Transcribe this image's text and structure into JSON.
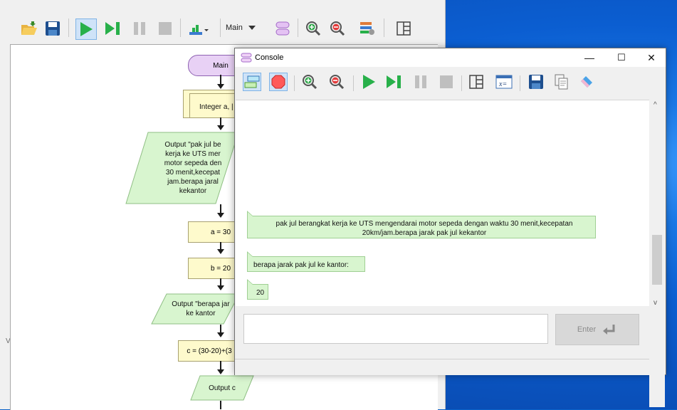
{
  "main_window": {
    "function_selector": "Main",
    "gutter_char": "V",
    "flowchart": {
      "start_label": "Main",
      "declare_label": "Integer a, |",
      "output1_lines": [
        "Output \"pak jul be",
        "kerja ke UTS mer",
        "motor sepeda den",
        "30 menit,kecepat",
        "jam.berapa jaral",
        "kekantor"
      ],
      "assign_a": "a = 30",
      "assign_b": "b = 20",
      "output2_lines": [
        "Output \"berapa jar",
        "ke kantor"
      ],
      "assign_c": "c = (30-20)+(3",
      "output_c": "Output c"
    }
  },
  "console": {
    "title": "Console",
    "minimize_glyph": "—",
    "maximize_glyph": "☐",
    "close_glyph": "✕",
    "messages": [
      {
        "line1": "pak jul berangkat kerja ke UTS mengendarai motor sepeda dengan waktu 30 menit,kecepatan",
        "line2": "20km/jam.berapa jarak pak jul kekantor"
      },
      {
        "line1": "berapa jarak pak jul ke kantor:"
      },
      {
        "line1": "20"
      }
    ],
    "input_value": "",
    "enter_label": "Enter",
    "scroll_up": "^",
    "scroll_down": "v"
  },
  "colors": {
    "terminal_fill": "#e8d1f5",
    "process_fill": "#fefacc",
    "io_fill": "#d8f5cf",
    "desktop": "#0a62c9"
  }
}
